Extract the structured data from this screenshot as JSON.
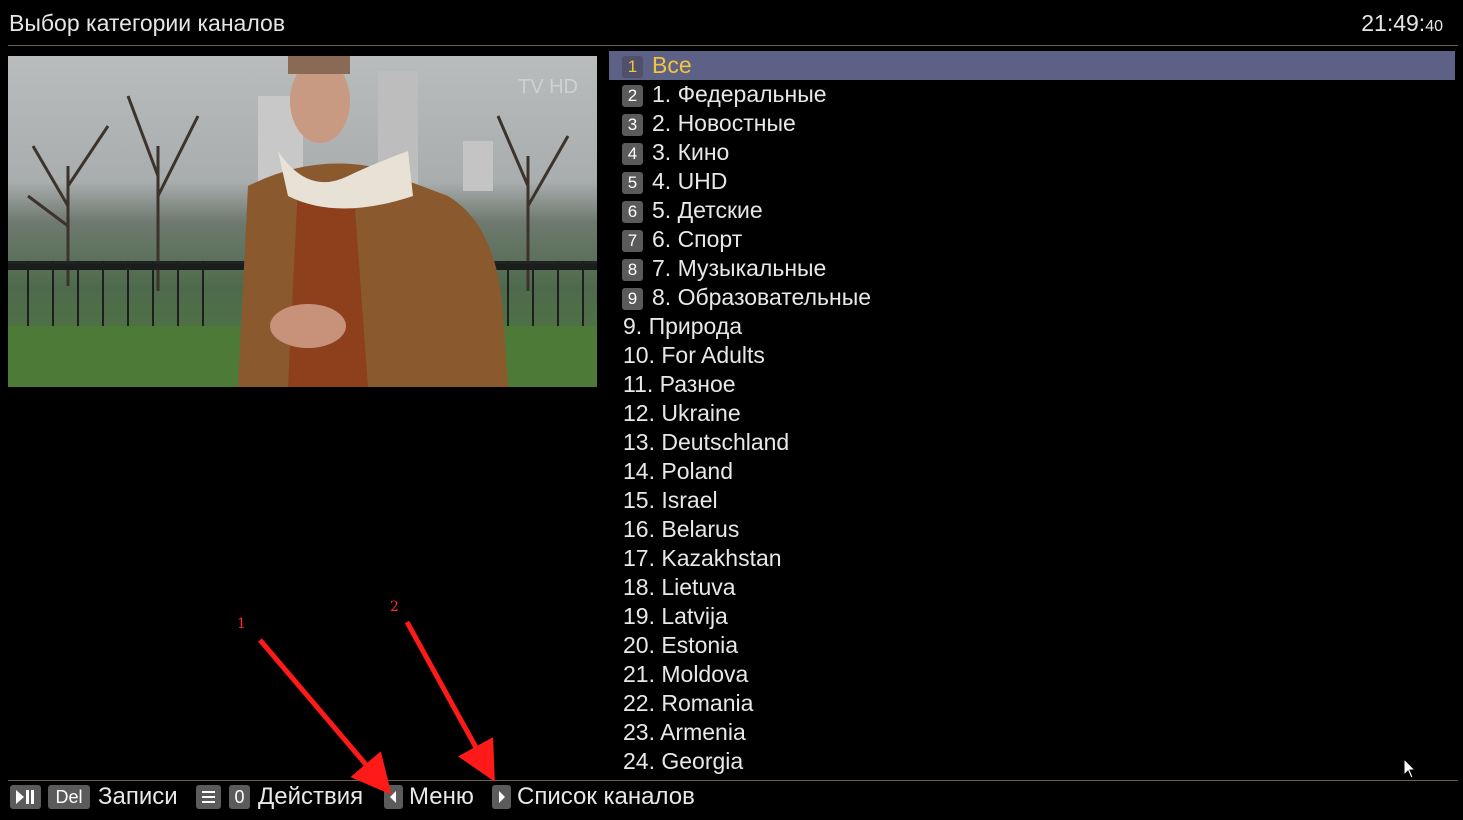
{
  "header": {
    "title": "Выбор категории каналов",
    "clock_hm": "21:49:",
    "clock_sec": "40"
  },
  "preview": {
    "watermark": "TV HD"
  },
  "categories": [
    {
      "num": "1",
      "label": "Все",
      "selected": true
    },
    {
      "num": "2",
      "label": "1. Федеральные"
    },
    {
      "num": "3",
      "label": "2. Новостные"
    },
    {
      "num": "4",
      "label": "3. Кино"
    },
    {
      "num": "5",
      "label": "4. UHD"
    },
    {
      "num": "6",
      "label": "5. Детские"
    },
    {
      "num": "7",
      "label": "6. Спорт"
    },
    {
      "num": "8",
      "label": "7. Музыкальные"
    },
    {
      "num": "9",
      "label": "8. Образовательные"
    },
    {
      "label": "9. Природа"
    },
    {
      "label": "10. For Adults"
    },
    {
      "label": "11. Разное"
    },
    {
      "label": "12. Ukraine"
    },
    {
      "label": "13. Deutschland"
    },
    {
      "label": "14. Poland"
    },
    {
      "label": "15. Israel"
    },
    {
      "label": "16. Belarus"
    },
    {
      "label": "17. Kazakhstan"
    },
    {
      "label": "18. Lietuva"
    },
    {
      "label": "19. Latvija"
    },
    {
      "label": "20. Estonia"
    },
    {
      "label": "21. Moldova"
    },
    {
      "label": "22. Romania"
    },
    {
      "label": "23. Armenia"
    },
    {
      "label": "24. Georgia"
    }
  ],
  "footer": {
    "del_key": "Del",
    "records_label": "Записи",
    "zero_key": "0",
    "actions_label": "Действия",
    "menu_label": "Меню",
    "channels_label": "Список каналов"
  },
  "annotations": {
    "label_1": "1",
    "label_2": "2",
    "arrow_color": "#ff1a1a"
  },
  "colors": {
    "selected_bg": "#5e6186",
    "selected_text": "#f3c53a",
    "divider": "#6e5f4a"
  },
  "icons": {
    "play_pause": "play-pause-icon",
    "menu": "menu-lines-icon",
    "left": "left-arrow-icon",
    "right": "right-arrow-icon",
    "cursor": "mouse-cursor-icon"
  }
}
